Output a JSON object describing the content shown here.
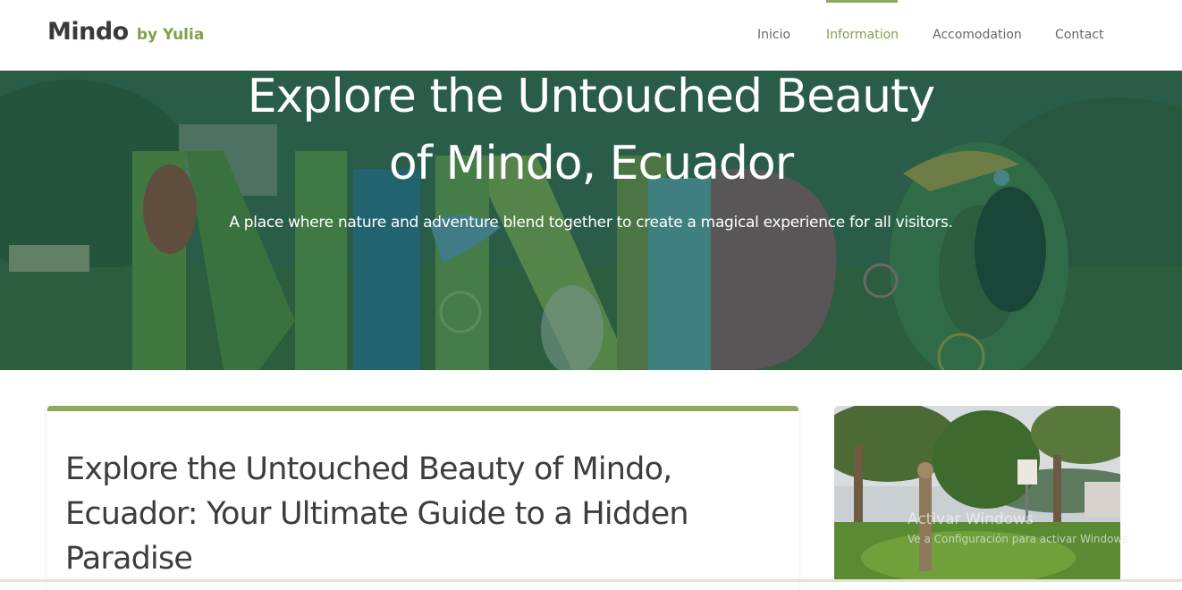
{
  "brand": {
    "name": "Mindo",
    "byline": "by Yulia"
  },
  "nav": {
    "items": [
      {
        "label": "Inicio",
        "active": false
      },
      {
        "label": "Information",
        "active": true
      },
      {
        "label": "Accomodation",
        "active": false
      },
      {
        "label": "Contact",
        "active": false
      }
    ]
  },
  "hero": {
    "title_line1": "Explore the Untouched Beauty",
    "title_line2": "of Mindo, Ecuador",
    "subtitle": "A place where nature and adventure blend together to create a magical experience for all visitors."
  },
  "article": {
    "title_line1": "Explore the Untouched Beauty of Mindo,",
    "title_line2": "Ecuador: Your Ultimate Guide to a Hidden",
    "title_line3": "Paradise"
  },
  "windows_watermark": {
    "title": "Activar Windows",
    "subtitle": "Ve a Configuración para activar Windows."
  },
  "colors": {
    "accent": "#8ea95a",
    "accent_text": "#7fa04c",
    "hero_overlay": "#1c5242",
    "text_dark": "#3d3d3d"
  }
}
